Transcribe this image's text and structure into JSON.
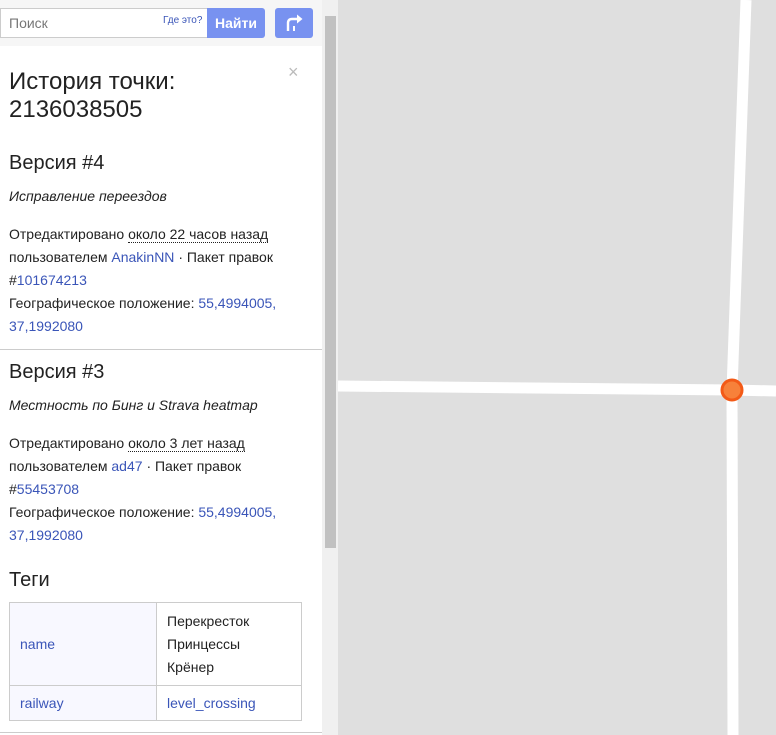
{
  "search": {
    "placeholder": "Поиск",
    "where_label": "Где это?",
    "submit_label": "Найти"
  },
  "panel": {
    "title": "История точки: 2136038505",
    "close_glyph": "×"
  },
  "versions": [
    {
      "heading": "Версия #4",
      "comment": "Исправление переездов",
      "edited_prefix": "Отредактировано",
      "edited_time": "около 22 часов назад",
      "by_label": "пользователем",
      "user": "AnakinNN",
      "changeset_label": "· Пакет правок",
      "changeset_hash": "#",
      "changeset_id": "101674213",
      "location_label": "Географическое положение:",
      "location": "55,4994005, 37,1992080"
    },
    {
      "heading": "Версия #3",
      "comment": "Местность по Бинг и Strava heatmap",
      "edited_prefix": "Отредактировано",
      "edited_time": "около 3 лет назад",
      "by_label": "пользователем",
      "user": "ad47",
      "changeset_label": "· Пакет правок",
      "changeset_hash": "#",
      "changeset_id": "55453708",
      "location_label": "Географическое положение:",
      "location": "55,4994005, 37,1992080"
    }
  ],
  "tags": {
    "title": "Теги",
    "rows": [
      {
        "key": "name",
        "value": "Перекресток Принцессы Крёнер"
      },
      {
        "key": "railway",
        "value": "level_crossing"
      }
    ]
  },
  "map": {
    "background_color": "#dfdfdf",
    "road_color": "#ffffff",
    "node_color": "#f7813a"
  }
}
